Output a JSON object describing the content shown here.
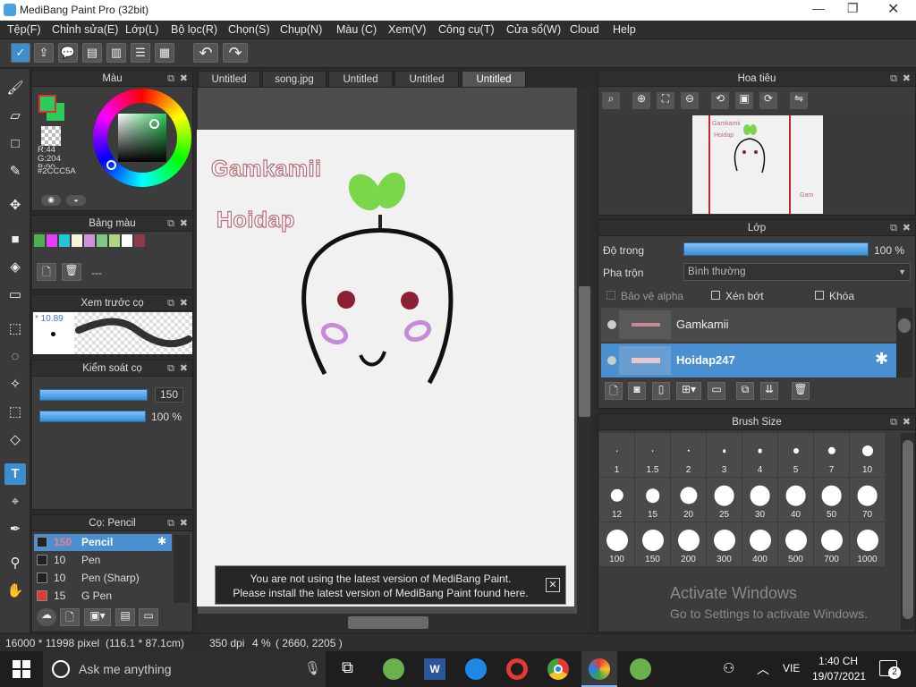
{
  "app": {
    "title": "MediBang Paint Pro (32bit)"
  },
  "menu": [
    "Tệp(F)",
    "Chỉnh sửa(E)",
    "Lớp(L)",
    "Bộ lọc(R)",
    "Chọn(S)",
    "Chụp(N)",
    "Màu (C)",
    "Xem(V)",
    "Công cụ(T)",
    "Cửa sổ(W)",
    "Cloud",
    "Help"
  ],
  "tabs": [
    "Untitled",
    "song.jpg",
    "Untitled",
    "Untitled",
    "Untitled"
  ],
  "color_panel": {
    "title": "Màu",
    "r": "R:44",
    "g": "G:204",
    "b": "B:90",
    "hex": "#2CCC5A",
    "fg_color": "#2ccc5a"
  },
  "palette_panel": {
    "title": "Bảng màu",
    "dash": "---"
  },
  "brush_preview": {
    "title": "Xem trước cọ",
    "size": "* 10.89"
  },
  "brush_control": {
    "title": "Kiểm soát cọ",
    "size": "150",
    "opacity": "100 %"
  },
  "brush_list": {
    "title": "Cọ: Pencil",
    "items": [
      {
        "size": "150",
        "name": "Pencil",
        "selected": true
      },
      {
        "size": "10",
        "name": "Pen"
      },
      {
        "size": "10",
        "name": "Pen (Sharp)"
      },
      {
        "size": "15",
        "name": "G Pen"
      }
    ]
  },
  "canvas": {
    "text1": "Gamkamii",
    "text2": "Hoidap"
  },
  "notification": {
    "line1": "You are not using the latest version of MediBang Paint.",
    "line2": "Please install the latest version of MediBang Paint found here."
  },
  "navigator": {
    "title": "Hoa tiêu",
    "thumb_text1": "Gamkamii",
    "thumb_text2": "Hoidap",
    "thumb_text3": "Gam"
  },
  "layers": {
    "title": "Lớp",
    "opacity_label": "Độ trong",
    "opacity_value": "100 %",
    "opacity_fraction": 1.0,
    "blend_label": "Pha trộn",
    "blend_value": "Bình thường",
    "protect_alpha": "Bảo vệ alpha",
    "clipping": "Xén bớt",
    "lock": "Khóa",
    "items": [
      {
        "name": "Gamkamii",
        "selected": false
      },
      {
        "name": "Hoidap247",
        "selected": true
      }
    ]
  },
  "brush_size": {
    "title": "Brush Size",
    "sizes": [
      "1",
      "1.5",
      "2",
      "3",
      "4",
      "5",
      "7",
      "10",
      "12",
      "15",
      "20",
      "25",
      "30",
      "40",
      "50",
      "70",
      "100",
      "150",
      "200",
      "300",
      "400",
      "500",
      "700",
      "1000"
    ]
  },
  "watermark": {
    "line1": "Activate Windows",
    "line2": "Go to Settings to activate Windows."
  },
  "status": {
    "dimensions": "16000 * 11998 pixel",
    "physical": "(116.1 * 87.1cm)",
    "dpi": "350 dpi",
    "zoom": "4 %",
    "coords": "( 2660, 2205 )"
  },
  "taskbar": {
    "search_placeholder": "Ask me anything",
    "lang": "VIE",
    "time": "1:40 CH",
    "date": "19/07/2021",
    "notification_count": "2"
  }
}
